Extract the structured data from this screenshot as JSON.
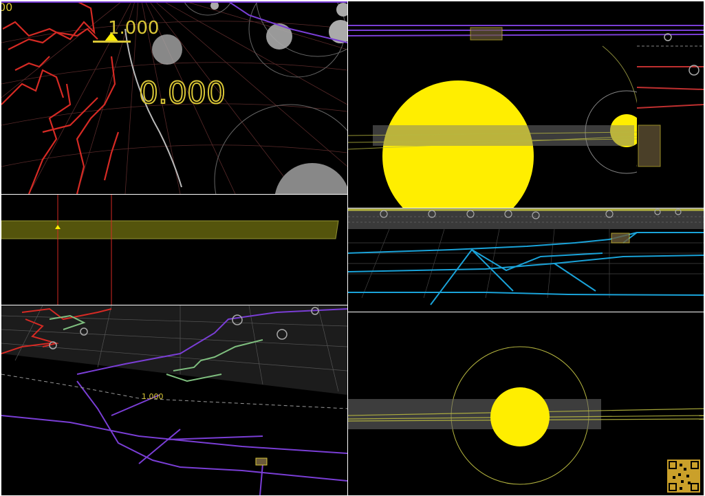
{
  "labels": {
    "top_left_scale": "1.000",
    "top_left_big": "0.000",
    "top_left_corner": "00",
    "bottom_left_scale": "1.000"
  },
  "colors": {
    "background": "#000000",
    "yellow": "#ffee00",
    "label_yellow": "#d9c636",
    "red_path": "#e0302a",
    "purple_path": "#7a3ed6",
    "cyan_path": "#1aa3d9",
    "green_path": "#7fbf7f",
    "grid": "#6a6a6a"
  },
  "icons": [
    "marker-triangle-icon",
    "waypoint-ring-icon",
    "qr-code-icon"
  ]
}
